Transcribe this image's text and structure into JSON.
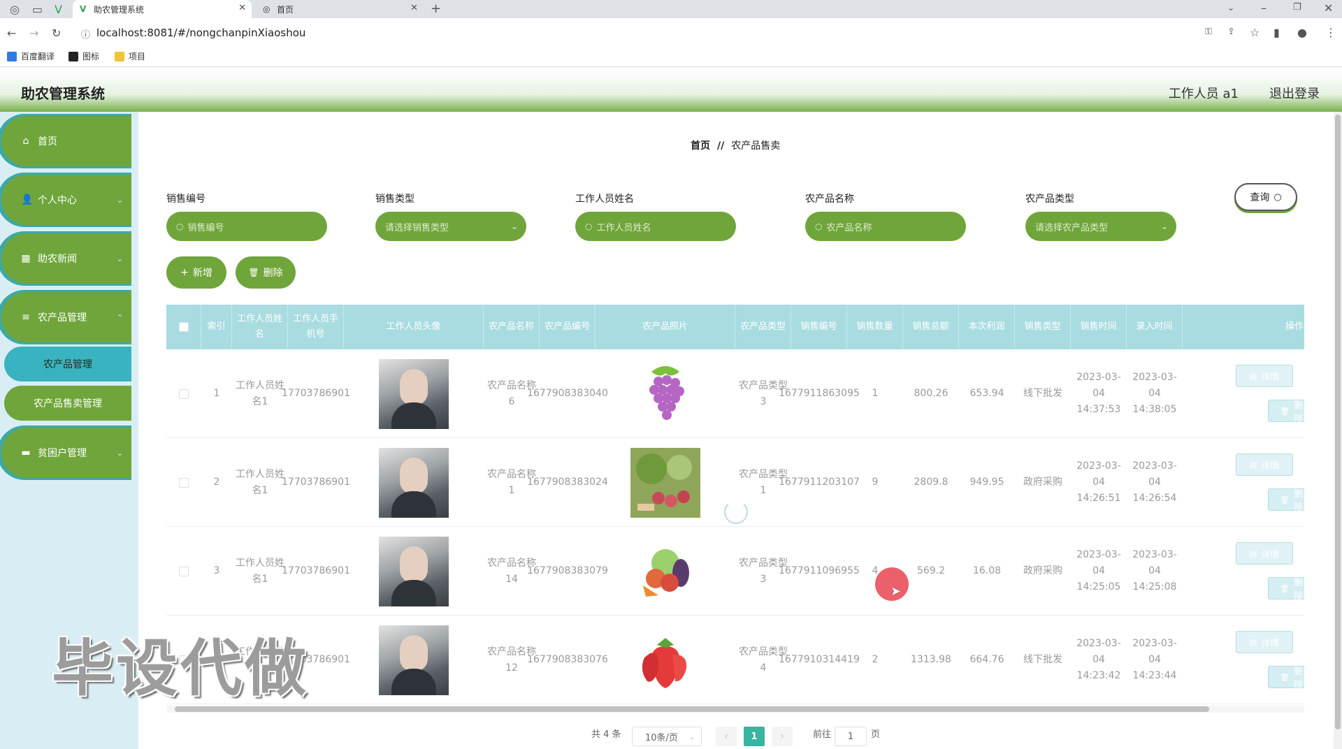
{
  "browser": {
    "tabs": [
      {
        "title": "助农管理系统"
      },
      {
        "title": "首页"
      }
    ],
    "url": "localhost:8081/#/nongchanpinXiaoshou",
    "bookmarks": [
      "百度翻译",
      "图标",
      "项目"
    ]
  },
  "header": {
    "title": "助农管理系统",
    "user": "工作人员 a1",
    "logout": "退出登录"
  },
  "sidebar": {
    "items": [
      {
        "label": "首页"
      },
      {
        "label": "个人中心"
      },
      {
        "label": "助农新闻"
      },
      {
        "label": "农产品管理"
      },
      {
        "label": "贫困户管理"
      }
    ],
    "sub_items": [
      {
        "label": "农产品管理"
      },
      {
        "label": "农产品售卖管理"
      }
    ]
  },
  "breadcrumb": {
    "home": "首页",
    "sep": "//",
    "current": "农产品售卖"
  },
  "search": {
    "fields": [
      {
        "label": "销售编号",
        "placeholder": "销售编号"
      },
      {
        "label": "销售类型",
        "placeholder": "请选择销售类型"
      },
      {
        "label": "工作人员姓名",
        "placeholder": "工作人员姓名"
      },
      {
        "label": "农产品名称",
        "placeholder": "农产品名称"
      },
      {
        "label": "农产品类型",
        "placeholder": "请选择农产品类型"
      }
    ],
    "query_label": "查询"
  },
  "actions": {
    "add": "新增",
    "delete": "删除"
  },
  "table": {
    "columns": [
      "索引",
      "工作人员姓名",
      "工作人员手机号",
      "工作人员头像",
      "农产品名称",
      "农产品编号",
      "农产品照片",
      "农产品类型",
      "销售编号",
      "销售数量",
      "销售总额",
      "本次利润",
      "销售类型",
      "销售时间",
      "录入时间",
      "操作"
    ],
    "rows": [
      {
        "index": "1",
        "worker": "工作人员姓名1",
        "phone": "17703786901",
        "product": "农产品名称6",
        "product_no": "1677908383040",
        "type": "农产品类型3",
        "sale_no": "1677911863095",
        "qty": "1",
        "total": "800.26",
        "profit": "653.94",
        "sale_type": "线下批发",
        "sale_time": "2023-03-04 14:37:53",
        "entry_time": "2023-03-04 14:38:05",
        "photo": "grapes"
      },
      {
        "index": "2",
        "worker": "工作人员姓名1",
        "phone": "17703786901",
        "product": "农产品名称1",
        "product_no": "1677908383024",
        "type": "农产品类型1",
        "sale_no": "1677911203107",
        "qty": "9",
        "total": "2809.8",
        "profit": "949.95",
        "sale_type": "政府采购",
        "sale_time": "2023-03-04 14:26:51",
        "entry_time": "2023-03-04 14:26:54",
        "photo": "vegetables"
      },
      {
        "index": "3",
        "worker": "工作人员姓名1",
        "phone": "17703786901",
        "product": "农产品名称14",
        "product_no": "1677908383079",
        "type": "农产品类型3",
        "sale_no": "1677911096955",
        "qty": "4",
        "total": "569.2",
        "profit": "16.08",
        "sale_type": "政府采购",
        "sale_time": "2023-03-04 14:25:05",
        "entry_time": "2023-03-04 14:25:08",
        "photo": "mixed"
      },
      {
        "index": "4",
        "worker": "工作人员姓名1",
        "phone": "17703786901",
        "product": "农产品名称12",
        "product_no": "1677908383076",
        "type": "农产品类型4",
        "sale_no": "1677910314419",
        "qty": "2",
        "total": "1313.98",
        "profit": "664.76",
        "sale_type": "线下批发",
        "sale_time": "2023-03-04 14:23:42",
        "entry_time": "2023-03-04 14:23:44",
        "photo": "strawberry"
      }
    ],
    "btn_detail": "详情",
    "btn_delete": "删除"
  },
  "pagination": {
    "total": "共 4 条",
    "page_size": "10条/页",
    "current": "1",
    "goto_prefix": "前往",
    "goto_value": "1",
    "goto_suffix": "页"
  },
  "watermark": "毕设代做",
  "colors": {
    "sidebar_green": "#6fa53a",
    "accent_teal": "#3ab3c0",
    "header_teal": "#a9dce1"
  }
}
